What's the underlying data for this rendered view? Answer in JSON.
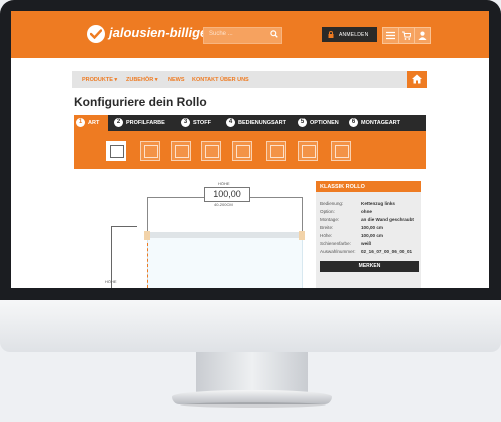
{
  "header": {
    "logo_text": "jalousien-billiger.de",
    "search_placeholder": "Suche ...",
    "login_label": "ANMELDEN",
    "accent": "#ee7b22"
  },
  "nav": {
    "items": [
      "PRODUKTE ▾",
      "ZUBEHÖR ▾",
      "NEWS",
      "KONTAKT",
      "ÜBER UNS"
    ]
  },
  "page_title": "Konfiguriere dein Rollo",
  "steps": [
    {
      "n": "1",
      "label": "ART"
    },
    {
      "n": "2",
      "label": "PROFILFARBE"
    },
    {
      "n": "3",
      "label": "STOFF"
    },
    {
      "n": "4",
      "label": "BEDIENUNGSART"
    },
    {
      "n": "5",
      "label": "OPTIONEN"
    },
    {
      "n": "6",
      "label": "MONTAGEART"
    }
  ],
  "preview": {
    "hoehe_label": "HÖHE",
    "value": "100,00",
    "range": "40-200CM",
    "side_label": "HÖHE"
  },
  "summary": {
    "title": "KLASSIK ROLLO",
    "rows": [
      {
        "k": "Bedienung:",
        "v": "Kettenzug links"
      },
      {
        "k": "Option:",
        "v": "ohne"
      },
      {
        "k": "Montage:",
        "v": "an die Wand geschraubt"
      },
      {
        "k": "Breite:",
        "v": "100,00 cm"
      },
      {
        "k": "Höhe:",
        "v": "100,00 cm"
      },
      {
        "k": "Schienenfarbe:",
        "v": "weiß"
      },
      {
        "k": "Auswahlnummer:",
        "v": "02_16_07_00_06_00_01"
      }
    ],
    "merken_label": "MERKEN"
  }
}
